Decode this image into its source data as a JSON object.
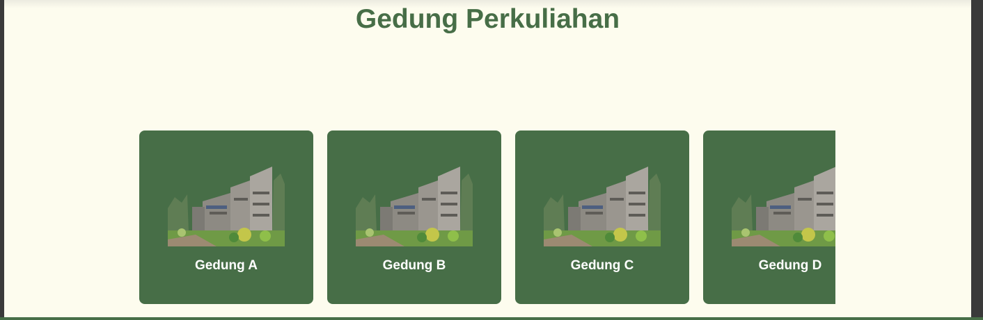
{
  "page": {
    "title": "Gedung Perkuliahan"
  },
  "colors": {
    "background": "#fdfcee",
    "accent": "#476e47",
    "card_text": "#ffffff"
  },
  "cards": [
    {
      "label": "Gedung A",
      "image": "building-photo"
    },
    {
      "label": "Gedung B",
      "image": "building-photo"
    },
    {
      "label": "Gedung C",
      "image": "building-photo"
    },
    {
      "label": "Gedung D",
      "image": "building-photo"
    }
  ]
}
